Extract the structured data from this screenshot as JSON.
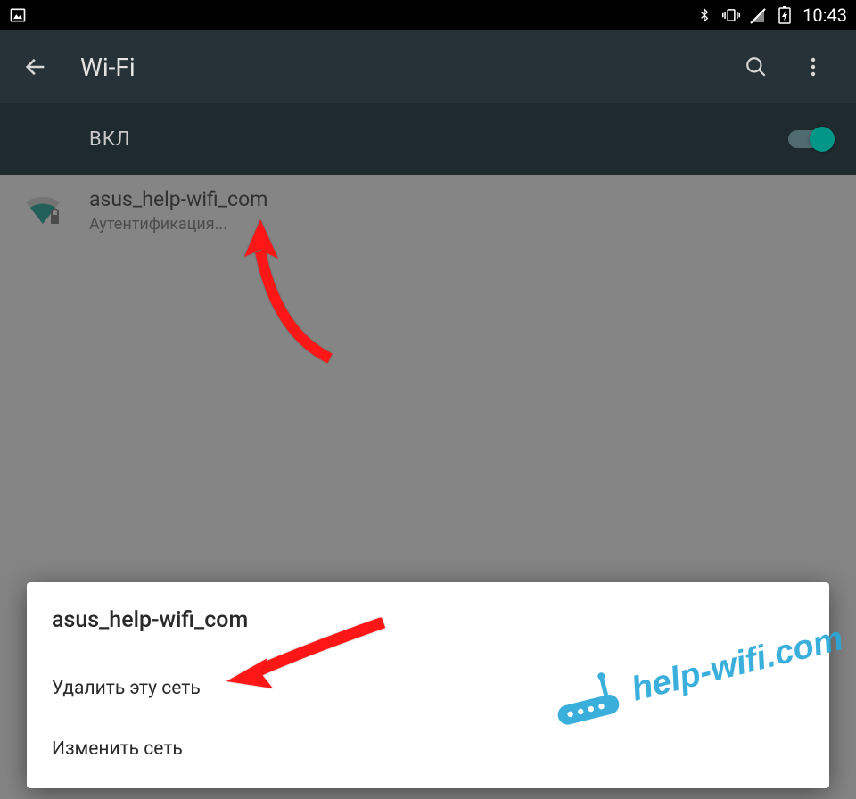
{
  "statusbar": {
    "time": "10:43",
    "icons": [
      "picture",
      "bluetooth",
      "vibrate",
      "no-sim",
      "battery-charging"
    ]
  },
  "appbar": {
    "title": "Wi-Fi"
  },
  "toggle": {
    "label": "ВКЛ",
    "on": true
  },
  "network": {
    "ssid": "asus_help-wifi_com",
    "status": "Аутентификация..."
  },
  "dialog": {
    "title": "asus_help-wifi_com",
    "delete_label": "Удалить эту сеть",
    "modify_label": "Изменить сеть"
  },
  "watermark": {
    "text": "help-wifi.com"
  },
  "colors": {
    "teal": "#009688",
    "watermark": "#2aa9d9",
    "arrow": "#ff1414"
  }
}
